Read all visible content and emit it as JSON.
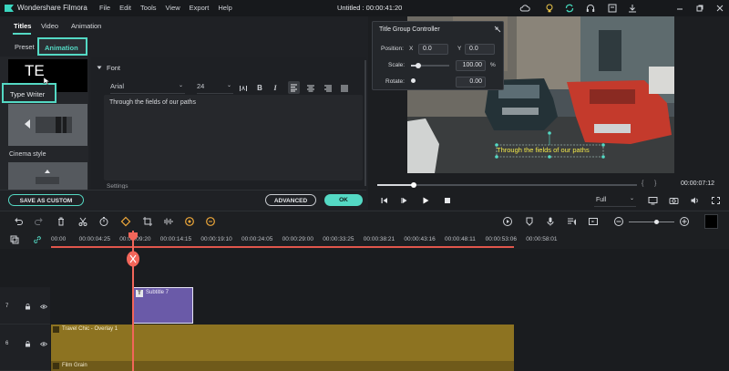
{
  "app": {
    "name": "Wondershare Filmora",
    "document_title": "Untitled : 00:00:41:20"
  },
  "menu": [
    "File",
    "Edit",
    "Tools",
    "View",
    "Export",
    "Help"
  ],
  "tabs": {
    "titles": "Titles",
    "video": "Video",
    "animation": "Animation"
  },
  "subtabs": {
    "preset": "Preset",
    "animation": "Animation"
  },
  "presets": {
    "te_thumb_text": "TE",
    "type_writer": "Type Writer",
    "cinema_style": "Cinema style"
  },
  "font_section": {
    "header": "Font",
    "font_family": "Arial",
    "font_size": "24",
    "text": "Through the fields of our paths",
    "next_section": "Settings"
  },
  "buttons": {
    "save_as_custom": "SAVE AS CUSTOM",
    "advanced": "ADVANCED",
    "ok": "OK"
  },
  "title_group_controller": {
    "title": "Title Group Controller",
    "position_label": "Position:",
    "x_label": "X",
    "x_value": "0.0",
    "y_label": "Y",
    "y_value": "0.0",
    "scale_label": "Scale:",
    "scale_value": "100.00",
    "scale_unit": "%",
    "rotate_label": "Rotate:",
    "rotate_value": "0.00",
    "scale_fraction": 0.2
  },
  "preview": {
    "overlay_text": "Through the fields of our paths",
    "timecode": "00:00:07:12",
    "quality": "Full",
    "progress_fraction": 0.14,
    "braces": "{      }"
  },
  "timeline": {
    "ruler": [
      "00:00",
      "00:00:04:25",
      "00:00:09:20",
      "00:00:14:15",
      "00:00:19:10",
      "00:00:24:05",
      "00:00:29:00",
      "00:00:33:25",
      "00:00:38:21",
      "00:00:43:16",
      "00:00:48:11",
      "00:00:53:06",
      "00:00:58:01"
    ],
    "tracks": [
      {
        "number": "7",
        "clip": "Subtitle 7"
      },
      {
        "number": "6",
        "clip": "Travel Chic - Overlay 1",
        "sub_clip": "Film Grain"
      }
    ]
  },
  "colors": {
    "accent": "#54d9c4",
    "playhead": "#f2665a",
    "subtitle_clip": "#6a5aa8",
    "overlay_clip": "#8d7321",
    "overlay_text": "#f3e94a"
  }
}
